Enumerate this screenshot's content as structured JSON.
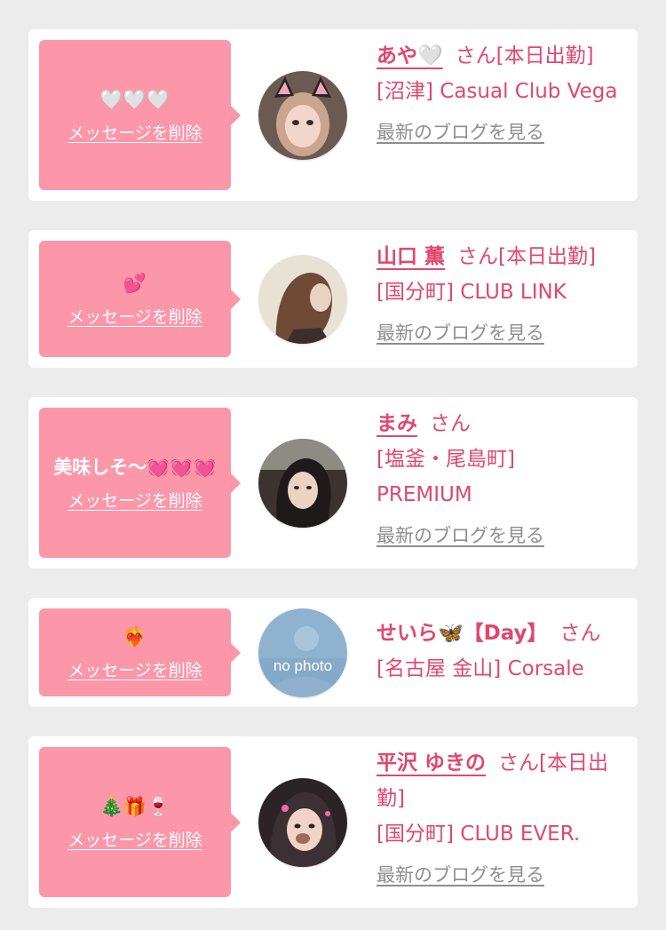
{
  "colors": {
    "background": "#ececec",
    "card": "#ffffff",
    "bubble": "#fc96a9",
    "accent": "#e0476e",
    "link_gray": "#8e8e8e"
  },
  "messages": [
    {
      "message": "🤍🤍🤍",
      "delete_label": "メッセージを削除",
      "name": "あや🤍",
      "suffix": "さん[本日出勤]",
      "shop": "[沼津] Casual Club Vega",
      "blog_link": "最新のブログを見る",
      "avatar_icon": "profile-photo-icon"
    },
    {
      "message": "💕",
      "delete_label": "メッセージを削除",
      "name": "山口 薫",
      "suffix": "さん[本日出勤]",
      "shop": "[国分町] CLUB LINK",
      "blog_link": "最新のブログを見る",
      "avatar_icon": "profile-photo-icon"
    },
    {
      "message": "美味しそ〜💓💓💓",
      "delete_label": "メッセージを削除",
      "name": "まみ",
      "suffix": "さん",
      "shop": "[塩釜・尾島町] PREMIUM",
      "blog_link": "最新のブログを見る",
      "avatar_icon": "profile-photo-icon"
    },
    {
      "message": "❤️‍🔥",
      "delete_label": "メッセージを削除",
      "name": "せいら🦋【Day】",
      "suffix": "さん",
      "shop": "[名古屋 金山] Corsale",
      "avatar_text": "no photo",
      "avatar_icon": "no-photo-icon"
    },
    {
      "message": "🎄🎁🍷",
      "delete_label": "メッセージを削除",
      "name": "平沢 ゆきの",
      "suffix": "さん[本日出勤]",
      "shop": "[国分町] CLUB EVER.",
      "blog_link": "最新のブログを見る",
      "avatar_icon": "profile-photo-icon"
    }
  ]
}
